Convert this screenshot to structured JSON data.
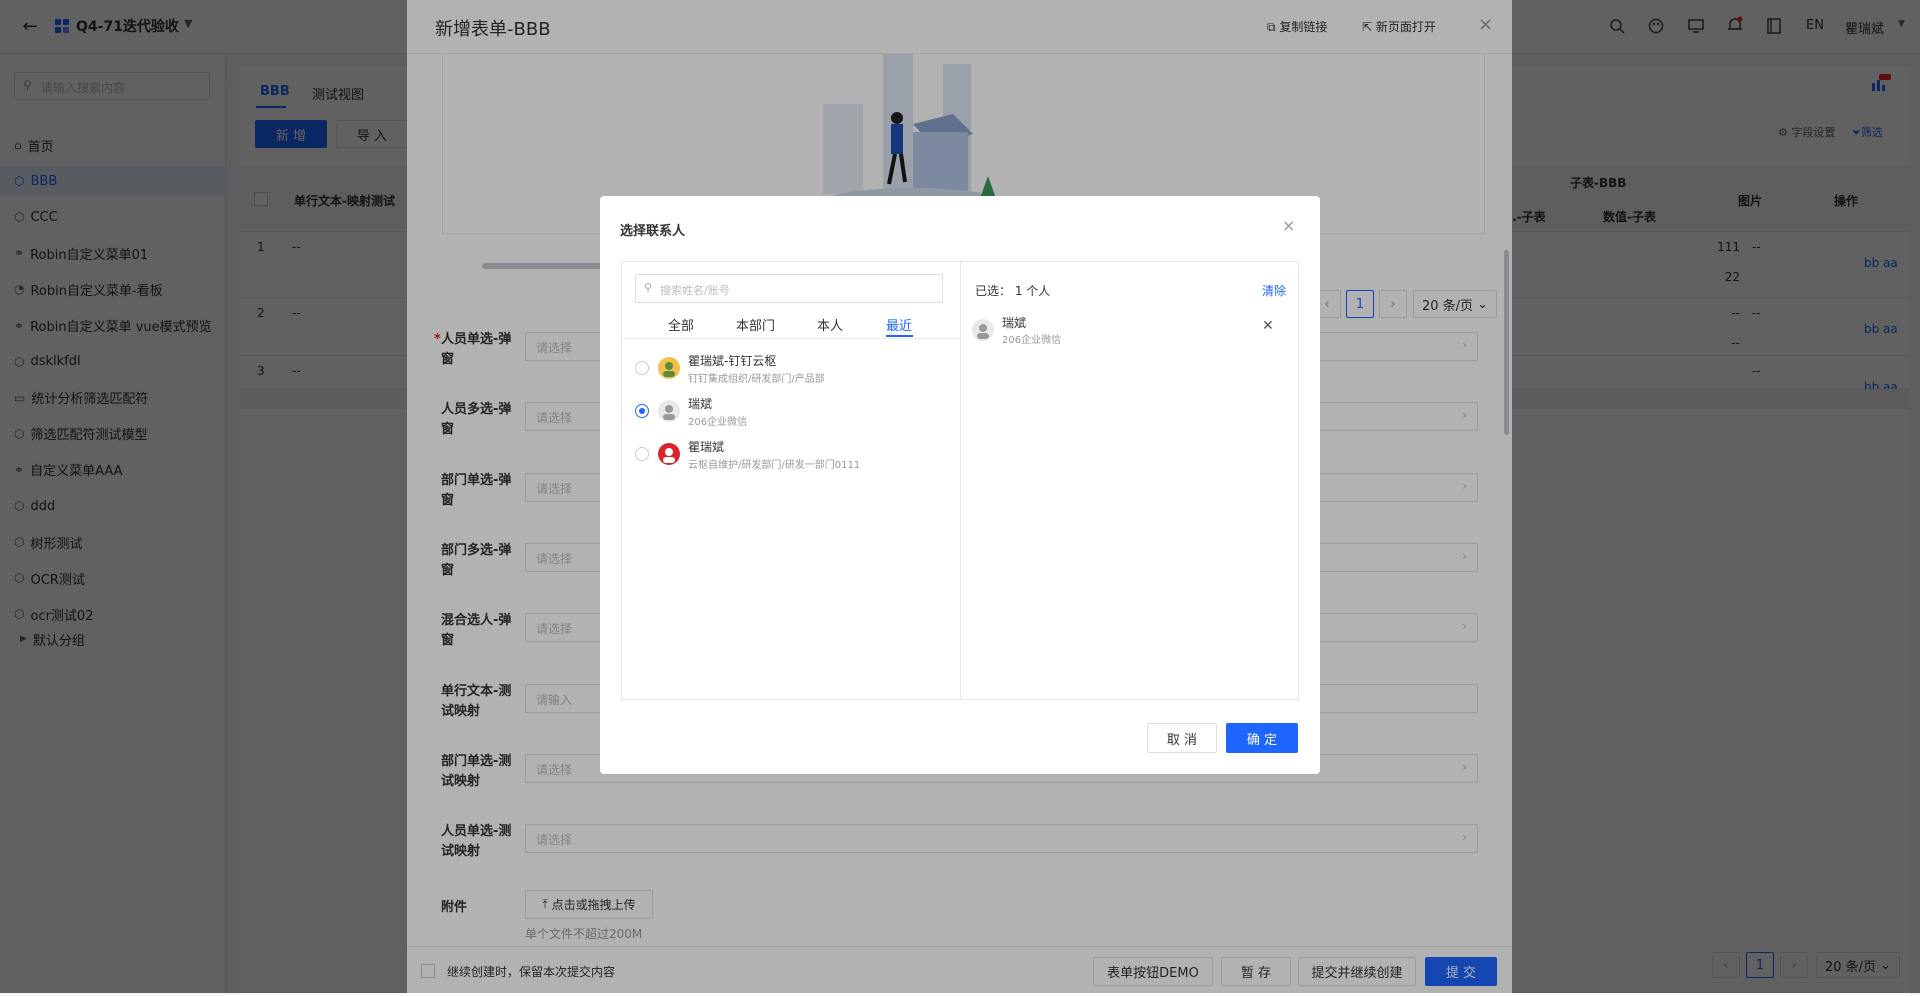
{
  "app": {
    "title": "Q4-71迭代验收",
    "user": "瞿瑞斌",
    "lang": "EN"
  },
  "sidebar": {
    "search_placeholder": "请输入搜索内容",
    "items": [
      {
        "label": "首页",
        "icon": "home-icon"
      },
      {
        "label": "BBB",
        "icon": "cube-icon"
      },
      {
        "label": "CCC",
        "icon": "cube-icon"
      },
      {
        "label": "Robin自定义菜单01",
        "icon": "link-icon"
      },
      {
        "label": "Robin自定义菜单-看板",
        "icon": "dashboard-icon"
      },
      {
        "label": "Robin自定义菜单 vue模式预览",
        "icon": "link-icon"
      },
      {
        "label": "dsklkfdl",
        "icon": "cube-icon"
      },
      {
        "label": "统计分析筛选匹配符",
        "icon": "chart-icon"
      },
      {
        "label": "筛选匹配符测试模型",
        "icon": "cube-icon"
      },
      {
        "label": "自定义菜单AAA",
        "icon": "link-icon"
      },
      {
        "label": "ddd",
        "icon": "cube-icon"
      },
      {
        "label": "树形测试",
        "icon": "cube-icon"
      },
      {
        "label": "OCR测试",
        "icon": "cube-icon"
      },
      {
        "label": "ocr测试02",
        "icon": "cube-icon"
      }
    ],
    "group_label": "默认分组"
  },
  "main": {
    "tabs": [
      "BBB",
      "测试视图"
    ],
    "add_button": "新 增",
    "import_button": "导 入",
    "field_settings": "字段设置",
    "filter": "筛选",
    "table_headers": {
      "col1": "单行文本-映射测试",
      "sub_group": "子表-BBB",
      "sub_a": "...-子表",
      "sub_b": "数值-子表",
      "image": "图片",
      "action": "操作"
    },
    "rows": [
      {
        "no": "1",
        "text": "--",
        "val1": "111",
        "val2": "22",
        "img": "--",
        "ops": "bb  aa"
      },
      {
        "no": "2",
        "text": "--",
        "val1": "--",
        "val2": "--",
        "img": "--",
        "ops": "bb  aa"
      },
      {
        "no": "3",
        "text": "--",
        "val1": "",
        "val2": "",
        "img": "--",
        "ops": "bb  aa"
      }
    ],
    "page": "1",
    "page_size": "20 条/页"
  },
  "drawer": {
    "title": "新增表单-BBB",
    "copy_link": "复制链接",
    "open_new": "新页面打开",
    "page": "1",
    "page_size": "20 条/页",
    "fields": [
      {
        "label": "人员单选-弹窗",
        "required": true,
        "placeholder": "请选择"
      },
      {
        "label": "人员多选-弹窗",
        "required": false,
        "placeholder": "请选择"
      },
      {
        "label": "部门单选-弹窗",
        "required": false,
        "placeholder": "请选择"
      },
      {
        "label": "部门多选-弹窗",
        "required": false,
        "placeholder": "请选择"
      },
      {
        "label": "混合选人-弹窗",
        "required": false,
        "placeholder": "请选择"
      },
      {
        "label": "单行文本-测试映射",
        "required": false,
        "placeholder": "请输入"
      },
      {
        "label": "部门单选-测试映射",
        "required": false,
        "placeholder": "请选择"
      },
      {
        "label": "人员单选-测试映射",
        "required": false,
        "placeholder": "请选择"
      }
    ],
    "attachment_label": "附件",
    "upload_button": "点击或拖拽上传",
    "upload_hint": "单个文件不超过200M",
    "keep_label": "继续创建时，保留本次提交内容",
    "btn_demo": "表单按钮DEMO",
    "btn_save": "暂 存",
    "btn_continue": "提交并继续创建",
    "btn_submit": "提 交"
  },
  "dialog": {
    "title": "选择联系人",
    "search_placeholder": "搜索姓名/账号",
    "tabs": [
      "全部",
      "本部门",
      "本人",
      "最近"
    ],
    "active_tab": 3,
    "contacts": [
      {
        "name": "瞿瑞斌-钉钉云枢",
        "dept": "钉钉集成组织/研发部门/产品部",
        "checked": false
      },
      {
        "name": "瑞斌",
        "dept": "206企业微信",
        "checked": true
      },
      {
        "name": "瞿瑞斌",
        "dept": "云枢自维护/研发部门/研发一部门0111",
        "checked": false
      }
    ],
    "selected_label": "已选：",
    "selected_count": "1 个人",
    "clear": "清除",
    "selected": [
      {
        "name": "瑞斌",
        "dept": "206企业微信"
      }
    ],
    "cancel": "取 消",
    "confirm": "确 定"
  },
  "colors": {
    "primary": "#1f66ff",
    "nav_active": "#0d5ecb"
  }
}
